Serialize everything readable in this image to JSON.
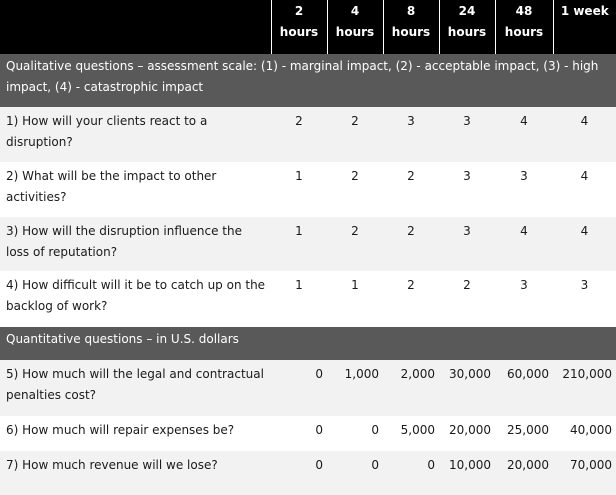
{
  "header": {
    "columns": [
      [
        "2",
        "hours"
      ],
      [
        "4",
        "hours"
      ],
      [
        "8",
        "hours"
      ],
      [
        "24",
        "hours"
      ],
      [
        "48",
        "hours"
      ],
      [
        "1 week",
        ""
      ]
    ]
  },
  "sections": [
    {
      "title": "Qualitative questions – assessment scale: (1) - marginal impact, (2) - acceptable impact, (3) - high impact, (4) - catastrophic impact",
      "rows": [
        {
          "question": "1) How will your clients react to a disruption?",
          "values": [
            "2",
            "2",
            "3",
            "3",
            "4",
            "4"
          ]
        },
        {
          "question": "2) What will be the impact to other activities?",
          "values": [
            "1",
            "2",
            "2",
            "3",
            "3",
            "4"
          ]
        },
        {
          "question": "3) How will the disruption influence the loss of reputation?",
          "values": [
            "1",
            "2",
            "2",
            "3",
            "4",
            "4"
          ]
        },
        {
          "question": "4) How difficult will it be to catch up on the backlog of work?",
          "values": [
            "1",
            "1",
            "2",
            "2",
            "3",
            "3"
          ]
        }
      ]
    },
    {
      "title": "Quantitative questions – in U.S. dollars",
      "rows": [
        {
          "question": "5) How much will the legal and contractual penalties cost?",
          "values": [
            "0",
            "1,000",
            "2,000",
            "30,000",
            "60,000",
            "210,000"
          ]
        },
        {
          "question": "6) How much will repair expenses be?",
          "values": [
            "0",
            "0",
            "5,000",
            "20,000",
            "25,000",
            "40,000"
          ]
        },
        {
          "question": "7) How much revenue will we lose?",
          "values": [
            "0",
            "0",
            "0",
            "10,000",
            "20,000",
            "70,000"
          ]
        }
      ]
    }
  ]
}
